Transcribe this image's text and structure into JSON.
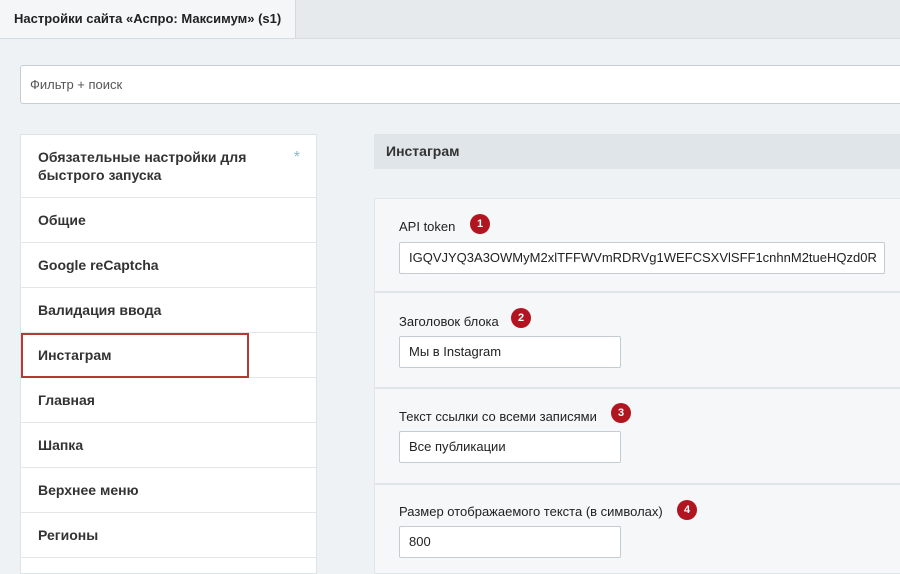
{
  "tab": {
    "title": "Настройки сайта «Аспро: Максимум» (s1)"
  },
  "filter": {
    "placeholder": "Фильтр + поиск"
  },
  "sidebar": {
    "items": [
      {
        "label": "Обязательные настройки для быстрого запуска",
        "marker": "*"
      },
      {
        "label": "Общие"
      },
      {
        "label": "Google reCaptcha"
      },
      {
        "label": "Валидация ввода"
      },
      {
        "label": "Инстаграм",
        "active": true
      },
      {
        "label": "Главная"
      },
      {
        "label": "Шапка"
      },
      {
        "label": "Верхнее меню"
      },
      {
        "label": "Регионы"
      }
    ]
  },
  "section": {
    "title": "Инстаграм"
  },
  "fields": [
    {
      "label": "API token",
      "badge": "1",
      "value": "IGQVJYQ3A3OWMyM2xlTFFWVmRDRVg1WEFCSXVlSFF1cnhnM2tueHQzd0R"
    },
    {
      "label": "Заголовок блока",
      "badge": "2",
      "value": "Мы в Instagram"
    },
    {
      "label": "Текст ссылки со всеми записями",
      "badge": "3",
      "value": "Все публикации"
    },
    {
      "label": "Размер отображаемого текста (в символах)",
      "badge": "4",
      "value": "800"
    }
  ],
  "colors": {
    "accent_border": "#b33a35",
    "badge": "#b1151f",
    "section_bg": "#dfe5e9"
  }
}
